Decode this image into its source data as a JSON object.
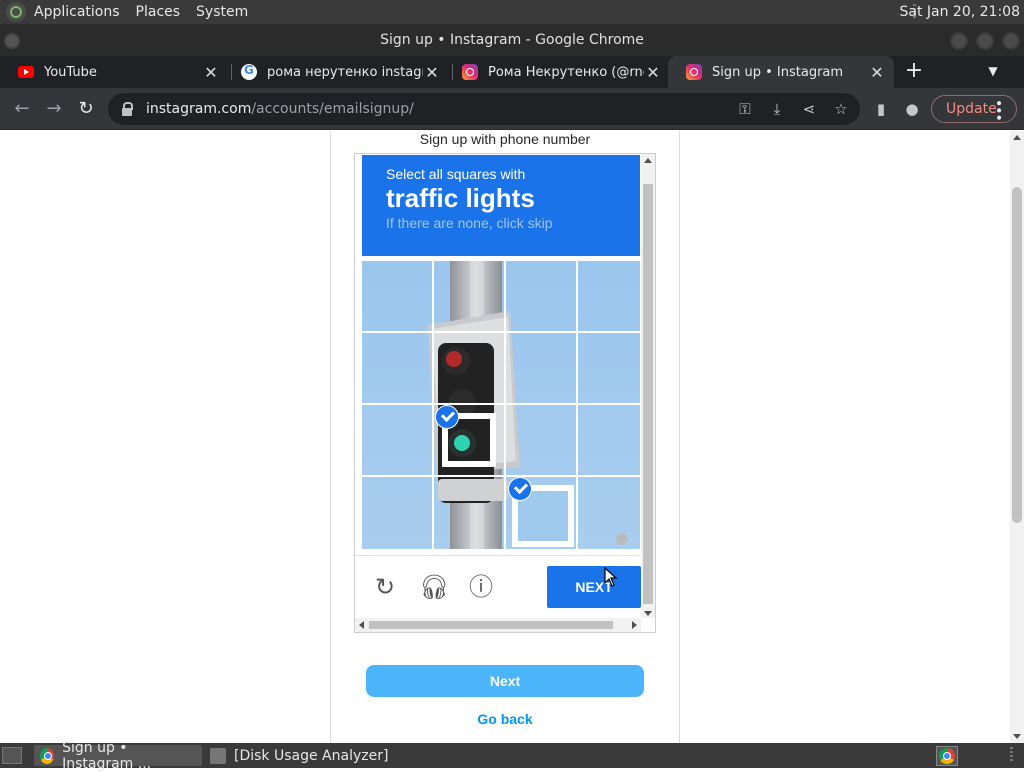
{
  "top_panel": {
    "menus": [
      "Applications",
      "Places",
      "System"
    ],
    "clock": "Sat Jan 20, 21:08"
  },
  "window": {
    "title": "Sign up • Instagram - Google Chrome"
  },
  "tabs": [
    {
      "title": "YouTube",
      "favicon": "youtube-icon",
      "active": false
    },
    {
      "title": "рома нерутенко instagram",
      "favicon": "google-icon",
      "active": false
    },
    {
      "title": "Рома Некрутенко (@rnekrutenko)",
      "favicon": "instagram-icon",
      "active": false
    },
    {
      "title": "Sign up • Instagram",
      "favicon": "instagram-icon",
      "active": true
    }
  ],
  "toolbar": {
    "url_host": "instagram.com",
    "url_path": "/accounts/emailsignup/",
    "update_label": "Update"
  },
  "page": {
    "signup_phone_text": "Sign up with phone number",
    "next_label": "Next",
    "go_back_label": "Go back"
  },
  "captcha": {
    "instruction": "Select all squares with",
    "target": "traffic lights",
    "hint": "If there are none, click skip",
    "next_label": "NEXT",
    "grid_rows": 4,
    "grid_cols": 4,
    "selected_cells": [
      [
        2,
        1
      ],
      [
        3,
        2
      ]
    ],
    "header_color": "#1a73e8"
  },
  "taskbar": {
    "tasks": [
      {
        "title": "Sign up • Instagram ...",
        "active": true
      },
      {
        "title": "[Disk Usage Analyzer]",
        "active": false
      }
    ]
  }
}
